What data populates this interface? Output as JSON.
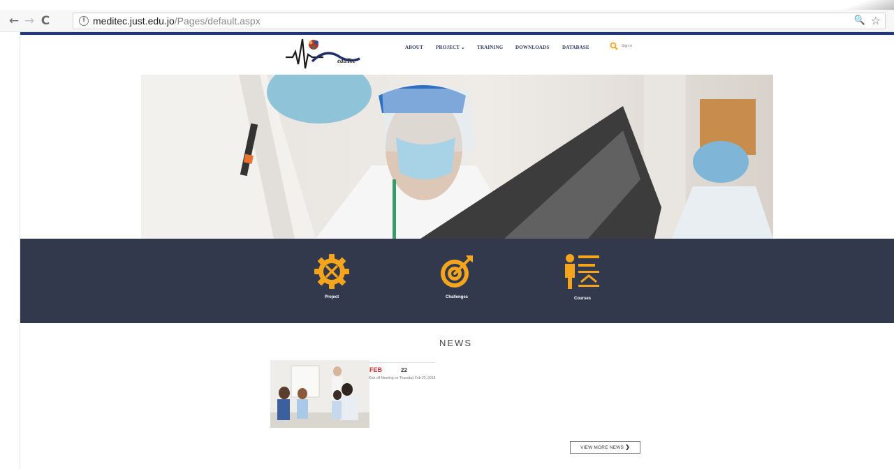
{
  "browser": {
    "url_host": "meditec.just.edu.jo",
    "url_path": "/Pages/default.aspx",
    "info_glyph": "i",
    "back_glyph": "←",
    "forward_glyph": "→",
    "reload_glyph": "C",
    "zoom_glyph": "🔍",
    "star_glyph": "☆"
  },
  "header": {
    "logo_text": "eduTec",
    "menu": {
      "about": "ABOUT",
      "project": "PROJECT ⌄",
      "training": "TRAINING",
      "downloads": "DOWNLOADS",
      "database": "DATABASE"
    },
    "signin": "Sign in"
  },
  "features": {
    "project": "Project",
    "challenges": "Challenges",
    "courses": "Courses"
  },
  "news": {
    "title": "NEWS",
    "item": {
      "month": "FEB",
      "day": "22",
      "text": "Kick off Meeting on Thursday Feb 22, 2018"
    },
    "more_label": "VIEW MORE NEWS",
    "more_glyph": "❯"
  },
  "colors": {
    "accent": "#f5a51c",
    "band": "#33394d",
    "topline": "#1f3a7a",
    "news_month": "#d12f2f"
  },
  "icons": [
    "info-icon",
    "back-arrow-icon",
    "forward-arrow-icon",
    "reload-icon",
    "zoom-icon",
    "bookmark-star-icon",
    "search-icon",
    "gear-wrench-icon",
    "target-icon",
    "teacher-board-icon"
  ]
}
